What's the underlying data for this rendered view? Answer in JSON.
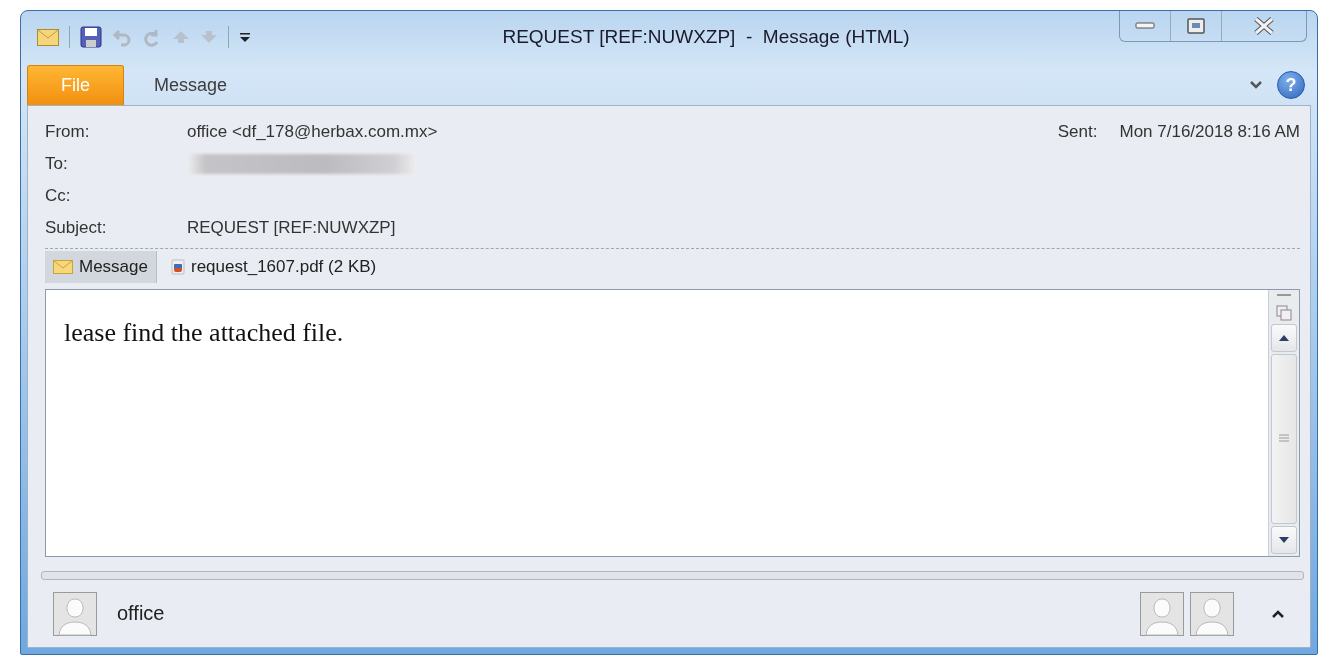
{
  "window": {
    "title": "REQUEST [REF:NUWXZP]  -  Message (HTML)"
  },
  "help_button": {
    "label": "?"
  },
  "ribbon_tabs": [
    {
      "label": "File",
      "selected": true
    },
    {
      "label": "Message",
      "selected": false
    }
  ],
  "header": {
    "fields": [
      {
        "label": "From:",
        "value": "office <df_178@herbax.com.mx>"
      },
      {
        "label": "To:",
        "redacted": true
      },
      {
        "label": "Cc:"
      },
      {
        "label": "Subject:",
        "value": "REQUEST [REF:NUWXZP]"
      }
    ],
    "sent_label": "Sent:",
    "sent_value": "Mon 7/16/2018 8:16 AM"
  },
  "attachments": [
    {
      "kind": "message",
      "label": "Message",
      "selected": true
    },
    {
      "kind": "pdf",
      "label": "request_1607.pdf (2 KB)",
      "selected": false
    }
  ],
  "body": {
    "text": "lease find the attached file."
  },
  "people_pane": {
    "name": "office"
  }
}
